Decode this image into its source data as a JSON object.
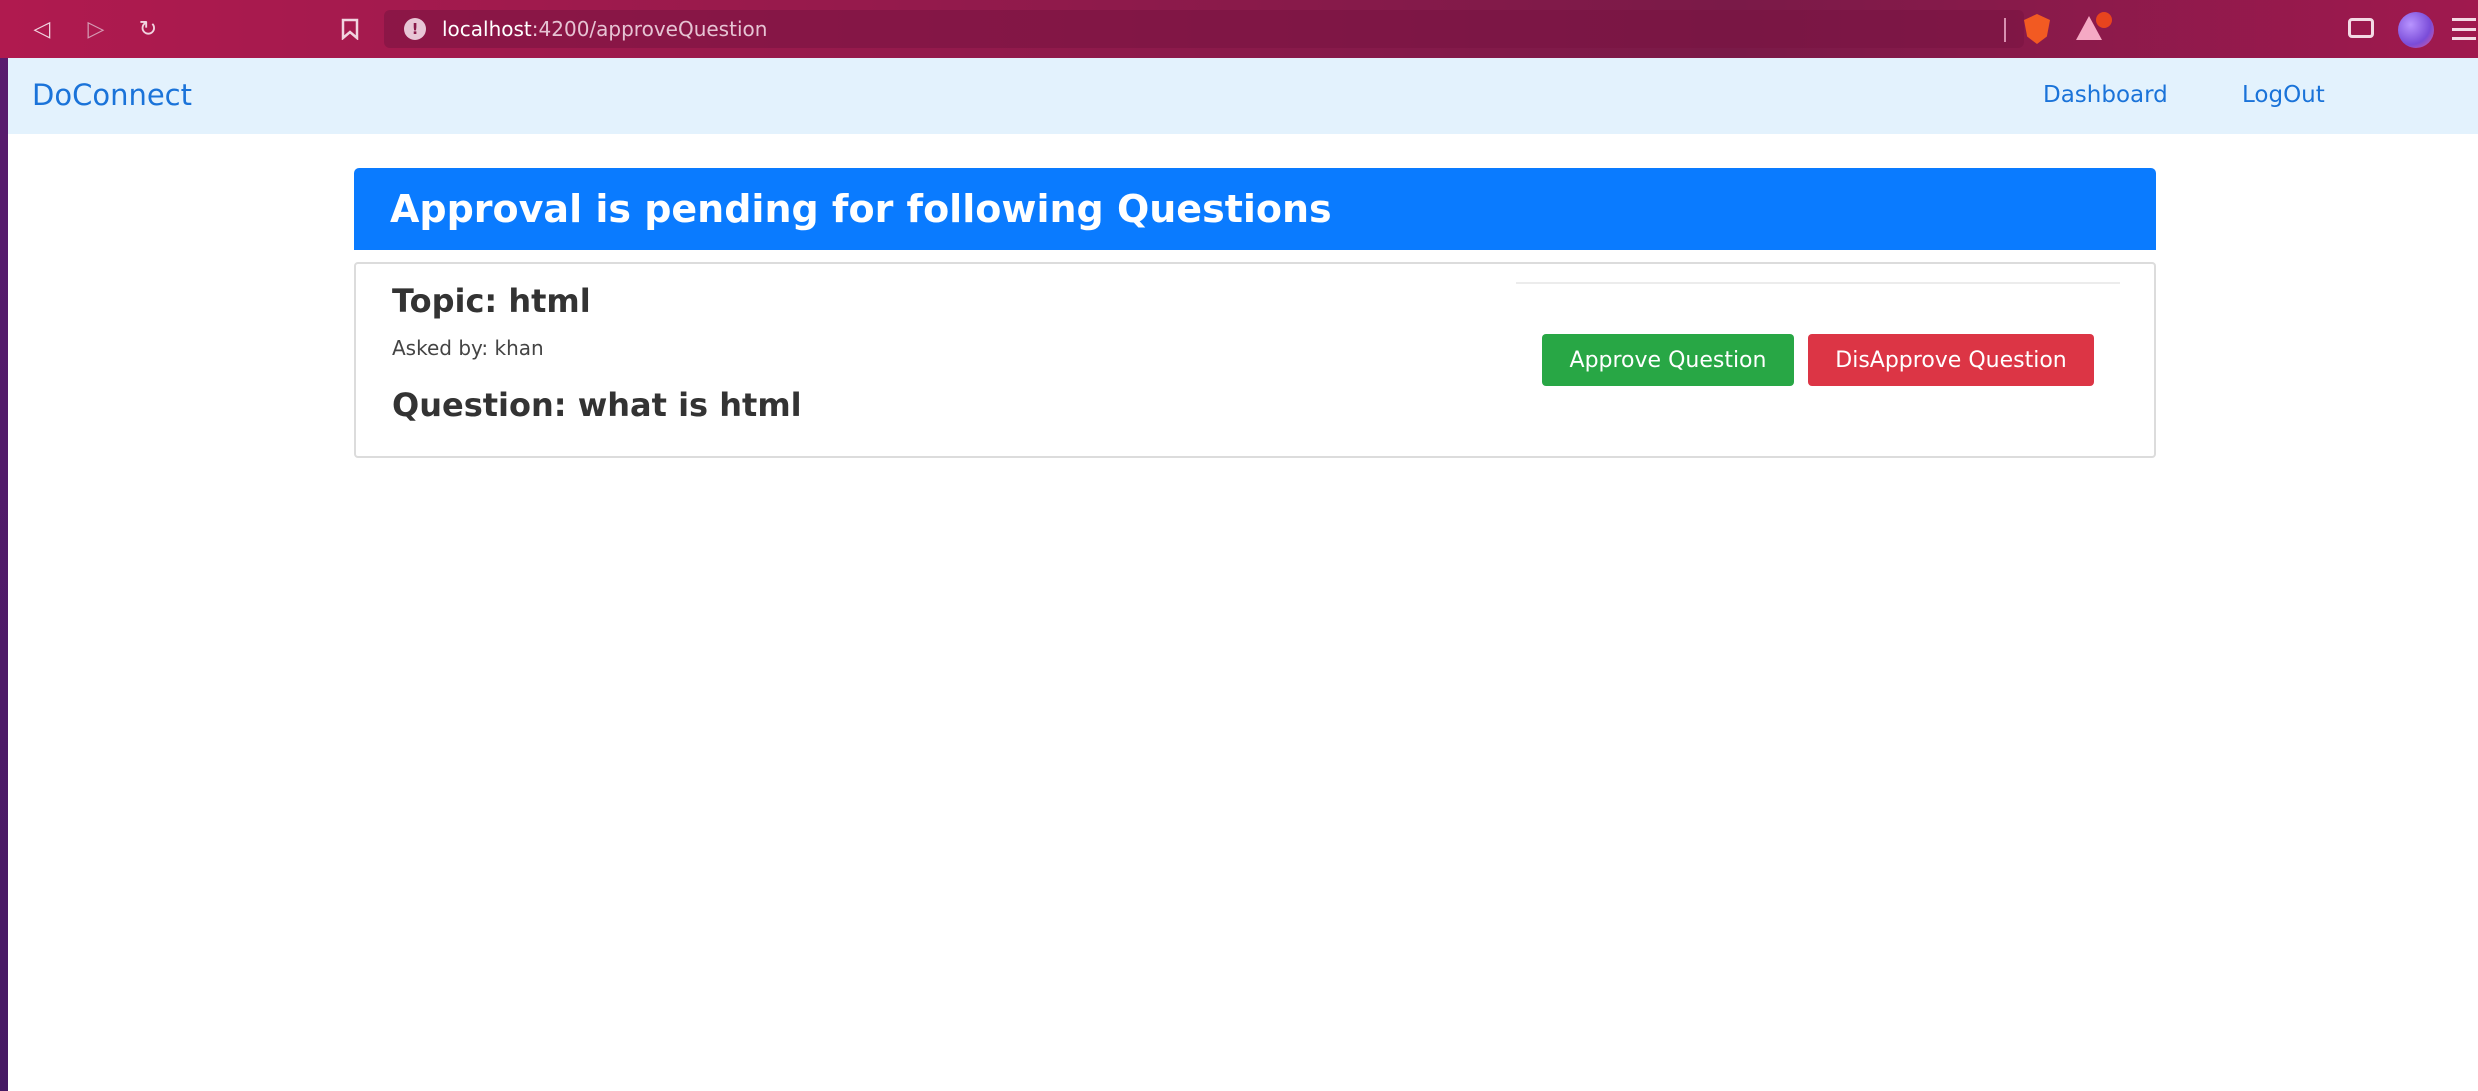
{
  "browser": {
    "url_host": "localhost",
    "url_path": ":4200/approveQuestion",
    "icons": {
      "back": "back-icon",
      "forward": "forward-icon",
      "reload": "reload-icon",
      "bookmark": "bookmark-icon",
      "site_info": "info-icon",
      "shields": "brave-shields-icon",
      "rewards": "brave-rewards-icon",
      "wallet": "wallet-icon",
      "profile": "profile-icon",
      "menu": "menu-icon"
    }
  },
  "navbar": {
    "brand": "DoConnect",
    "links": [
      {
        "label": "Dashboard"
      },
      {
        "label": "LogOut"
      }
    ]
  },
  "page": {
    "header_title": "Approval is pending for following Questions"
  },
  "questions": [
    {
      "topic": "Topic: html",
      "asked_by": "Asked by: khan",
      "question": "Question: what is html",
      "approve_label": "Approve Question",
      "disapprove_label": "DisApprove Question"
    }
  ],
  "colors": {
    "header": "#0a7bff",
    "approve": "#28a745",
    "disapprove": "#dc3545",
    "navbar_bg": "#e3f2fd",
    "link": "#1a73d9"
  }
}
